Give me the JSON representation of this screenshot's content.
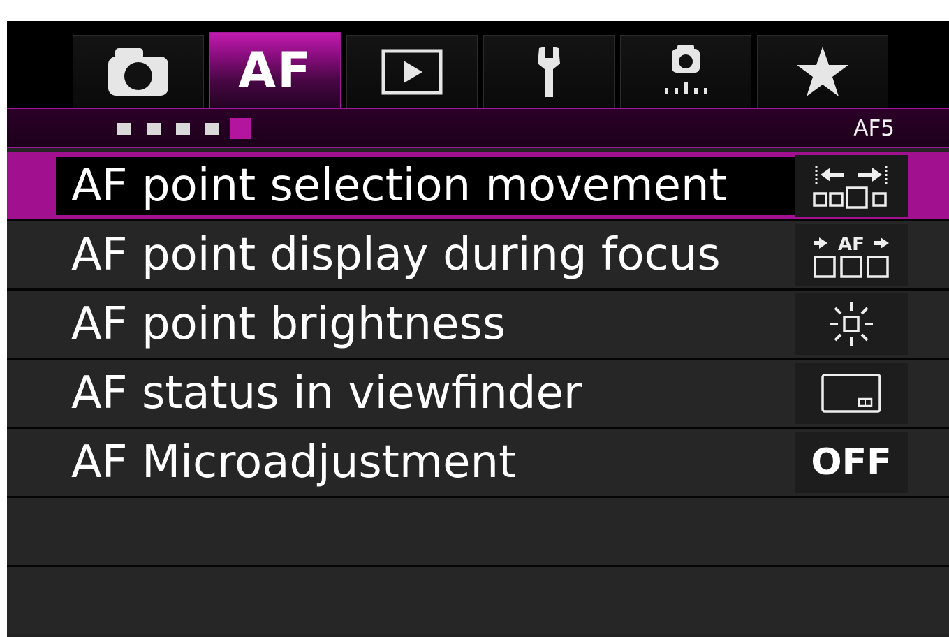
{
  "tabs": [
    {
      "name": "shooting",
      "icon": "camera-icon"
    },
    {
      "name": "af",
      "label": "AF",
      "active": true
    },
    {
      "name": "playback",
      "icon": "play-icon"
    },
    {
      "name": "setup",
      "icon": "wrench-icon"
    },
    {
      "name": "custom-functions",
      "icon": "camera-custom-icon"
    },
    {
      "name": "my-menu",
      "icon": "star-icon"
    }
  ],
  "page": {
    "name": "AF5",
    "total_pages": 5,
    "current_page": 5
  },
  "menu": {
    "items": [
      {
        "label": "AF point selection movement",
        "setting_icon": "af-point-movement-icon",
        "selected": true
      },
      {
        "label": "AF point display during focus",
        "setting_icon": "af-point-display-icon"
      },
      {
        "label": "AF point brightness",
        "setting_icon": "brightness-icon"
      },
      {
        "label": "AF status in viewfinder",
        "setting_icon": "viewfinder-status-icon"
      },
      {
        "label": "AF Microadjustment",
        "setting_value": "OFF"
      }
    ],
    "af_display_icon_text": "AF"
  },
  "colors": {
    "accent": "#a0108f",
    "background": "#000000",
    "row": "#262626"
  }
}
